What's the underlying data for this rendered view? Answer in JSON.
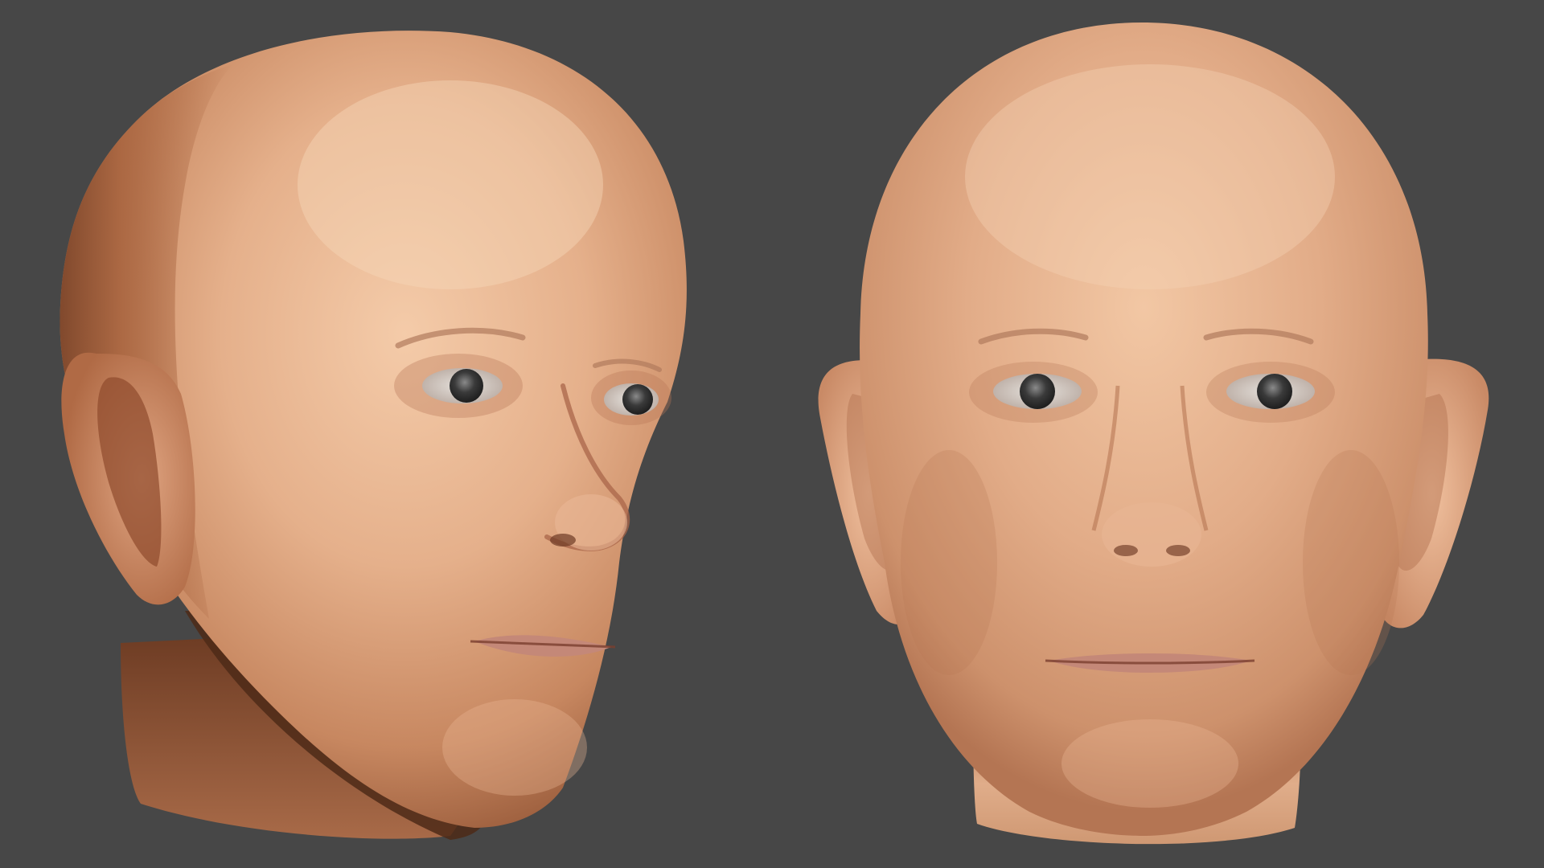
{
  "scene": {
    "background_color": "#474747",
    "skin_color": "#d9a07c",
    "skin_highlight": "#f3c8a6",
    "skin_shadow": "#8c5236",
    "neck_shadow": "#5a3320",
    "eye_color": "#4a4a4a",
    "sclera_color": "#d8d4cf",
    "lip_color": "#c48878",
    "renders": [
      {
        "label": "head-three-quarter-view"
      },
      {
        "label": "head-front-view"
      }
    ]
  }
}
